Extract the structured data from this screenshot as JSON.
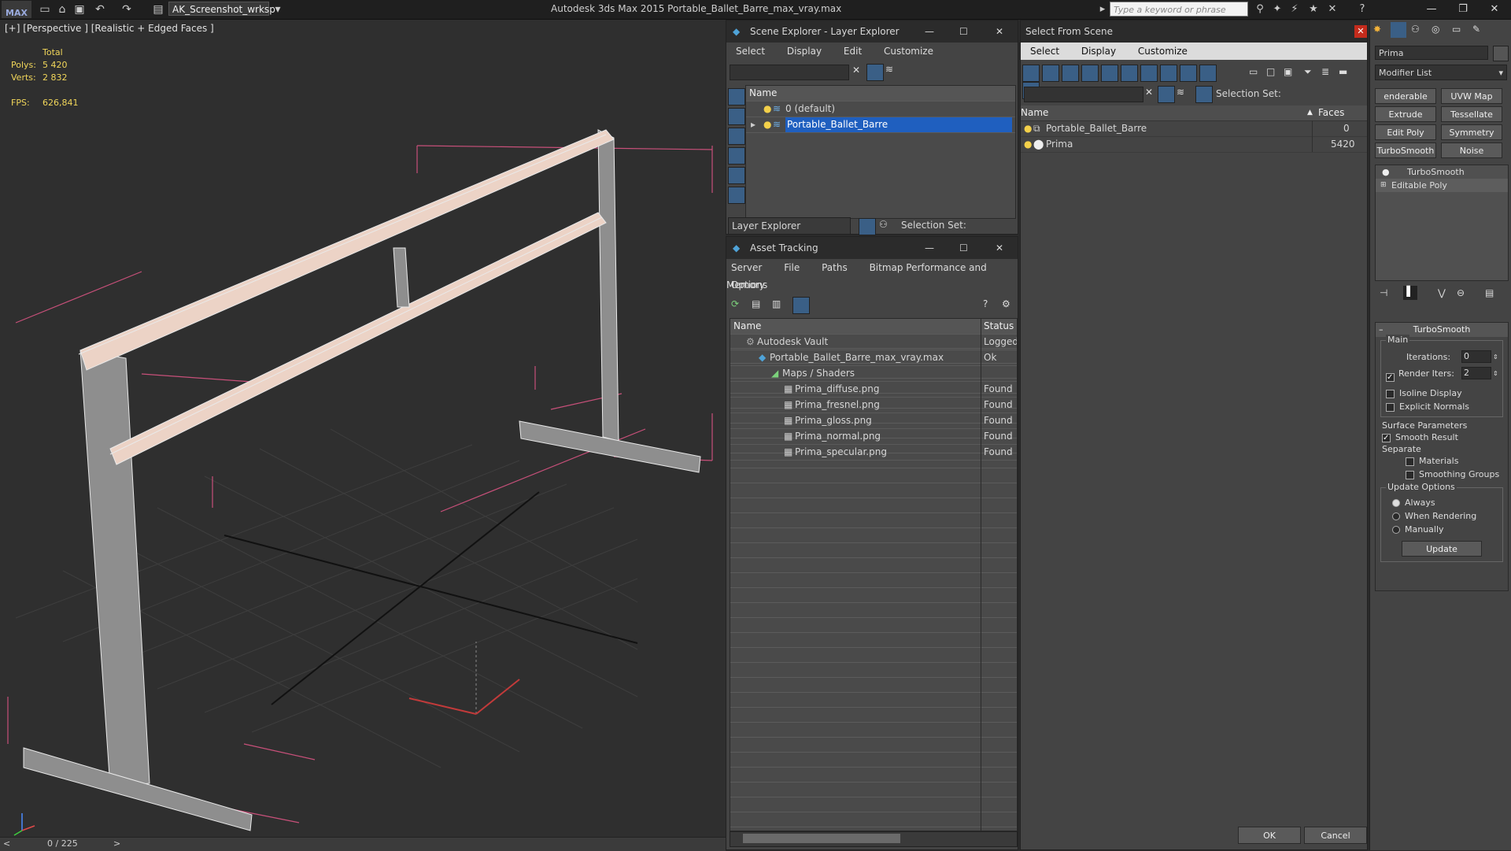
{
  "app": {
    "logo": "MAX",
    "workspace": "AK_Screenshot_wrksp",
    "title": "Autodesk 3ds Max  2015      Portable_Ballet_Barre_max_vray.max",
    "search_placeholder": "Type a keyword or phrase"
  },
  "viewport": {
    "label": "[+] [Perspective ] [Realistic + Edged Faces ]",
    "stats": {
      "total_label": "Total",
      "polys_label": "Polys:",
      "polys_value": "5 420",
      "verts_label": "Verts:",
      "verts_value": "2 832",
      "fps_label": "FPS:",
      "fps_value": "626,841"
    },
    "timeline": "0 / 225"
  },
  "scene_explorer": {
    "title": "Scene Explorer - Layer Explorer",
    "menu": [
      "Select",
      "Display",
      "Edit",
      "Customize"
    ],
    "col_name": "Name",
    "rows": [
      {
        "label": "0 (default)",
        "selected": false
      },
      {
        "label": "Portable_Ballet_Barre",
        "selected": true
      }
    ],
    "footer_dropdown": "Layer Explorer",
    "selection_set": "Selection Set:"
  },
  "asset_tracking": {
    "title": "Asset Tracking",
    "menu": [
      "Server",
      "File",
      "Paths",
      "Bitmap Performance and Memory"
    ],
    "menu2": "Options",
    "col_name": "Name",
    "col_status": "Status",
    "rows": [
      {
        "name": "Autodesk Vault",
        "status": "Logged",
        "indent": 1
      },
      {
        "name": "Portable_Ballet_Barre_max_vray.max",
        "status": "Ok",
        "indent": 2
      },
      {
        "name": "Maps / Shaders",
        "status": "",
        "indent": 3
      },
      {
        "name": "Prima_diffuse.png",
        "status": "Found",
        "indent": 4
      },
      {
        "name": "Prima_fresnel.png",
        "status": "Found",
        "indent": 4
      },
      {
        "name": "Prima_gloss.png",
        "status": "Found",
        "indent": 4
      },
      {
        "name": "Prima_normal.png",
        "status": "Found",
        "indent": 4
      },
      {
        "name": "Prima_specular.png",
        "status": "Found",
        "indent": 4
      }
    ]
  },
  "select_from_scene": {
    "title": "Select From Scene",
    "menu": [
      "Select",
      "Display",
      "Customize"
    ],
    "selection_set": "Selection Set:",
    "col_name": "Name",
    "col_faces": "Faces",
    "rows": [
      {
        "name": "Portable_Ballet_Barre",
        "faces": "0"
      },
      {
        "name": "Prima",
        "faces": "5420"
      }
    ],
    "ok": "OK",
    "cancel": "Cancel"
  },
  "command_panel": {
    "object_name": "Prima",
    "modifier_list": "Modifier List",
    "buttons": [
      "enderable Spli",
      "UVW Map",
      "Extrude",
      "Tessellate",
      "Edit Poly",
      "Symmetry",
      "TurboSmooth",
      "Noise"
    ],
    "stack": [
      "TurboSmooth",
      "Editable Poly"
    ],
    "rollout_title": "TurboSmooth",
    "main_label": "Main",
    "iterations_label": "Iterations:",
    "iterations_value": "0",
    "render_iters_label": "Render Iters:",
    "render_iters_value": "2",
    "isoline": "Isoline Display",
    "explicit": "Explicit Normals",
    "surface_label": "Surface Parameters",
    "smooth_result": "Smooth Result",
    "separate_label": "Separate",
    "materials": "Materials",
    "smoothing_groups": "Smoothing Groups",
    "update_label": "Update Options",
    "always": "Always",
    "when_rendering": "When Rendering",
    "manually": "Manually",
    "update_btn": "Update"
  },
  "colors": {
    "selection_blue": "#1f5fbf",
    "stat_yellow": "#f1d65a",
    "close_red": "#c42b1c"
  }
}
